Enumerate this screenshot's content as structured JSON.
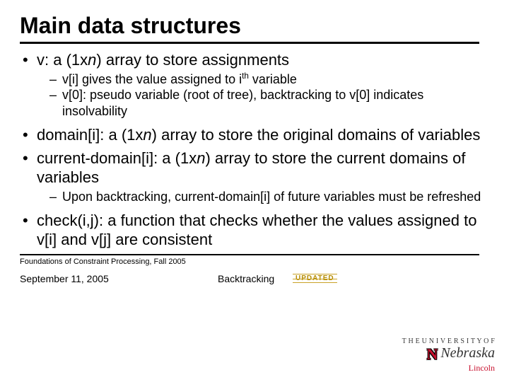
{
  "title": "Main data structures",
  "bullets": {
    "b1": {
      "pre": "v: a (1x",
      "n": "n",
      "post": ") array to store assignments",
      "sub1_pre": "v[i] gives the value assigned to i",
      "sub1_sup": "th",
      "sub1_post": " variable",
      "sub2": "v[0]: pseudo variable (root of tree), backtracking to v[0] indicates insolvability"
    },
    "b2": {
      "pre": "domain[i]: a (1x",
      "n": "n",
      "post": ") array to store the original domains of variables"
    },
    "b3": {
      "pre": "current-domain[i]: a (1x",
      "n": "n",
      "post": ") array to store the current domains of variables",
      "sub1": "Upon backtracking, current-domain[i] of future variables must be refreshed"
    },
    "b4": "check(i,j): a function that checks whether the values assigned to v[i] and v[j] are consistent"
  },
  "footer": {
    "course": "Foundations of Constraint Processing, Fall 2005",
    "date": "September 11, 2005",
    "topic": "Backtracking",
    "updated": "UPDATED"
  },
  "logo": {
    "line1": "T H E   U N I V E R S I T Y   O F",
    "name": "Nebraska",
    "city": "Lincoln",
    "mark": "N"
  }
}
